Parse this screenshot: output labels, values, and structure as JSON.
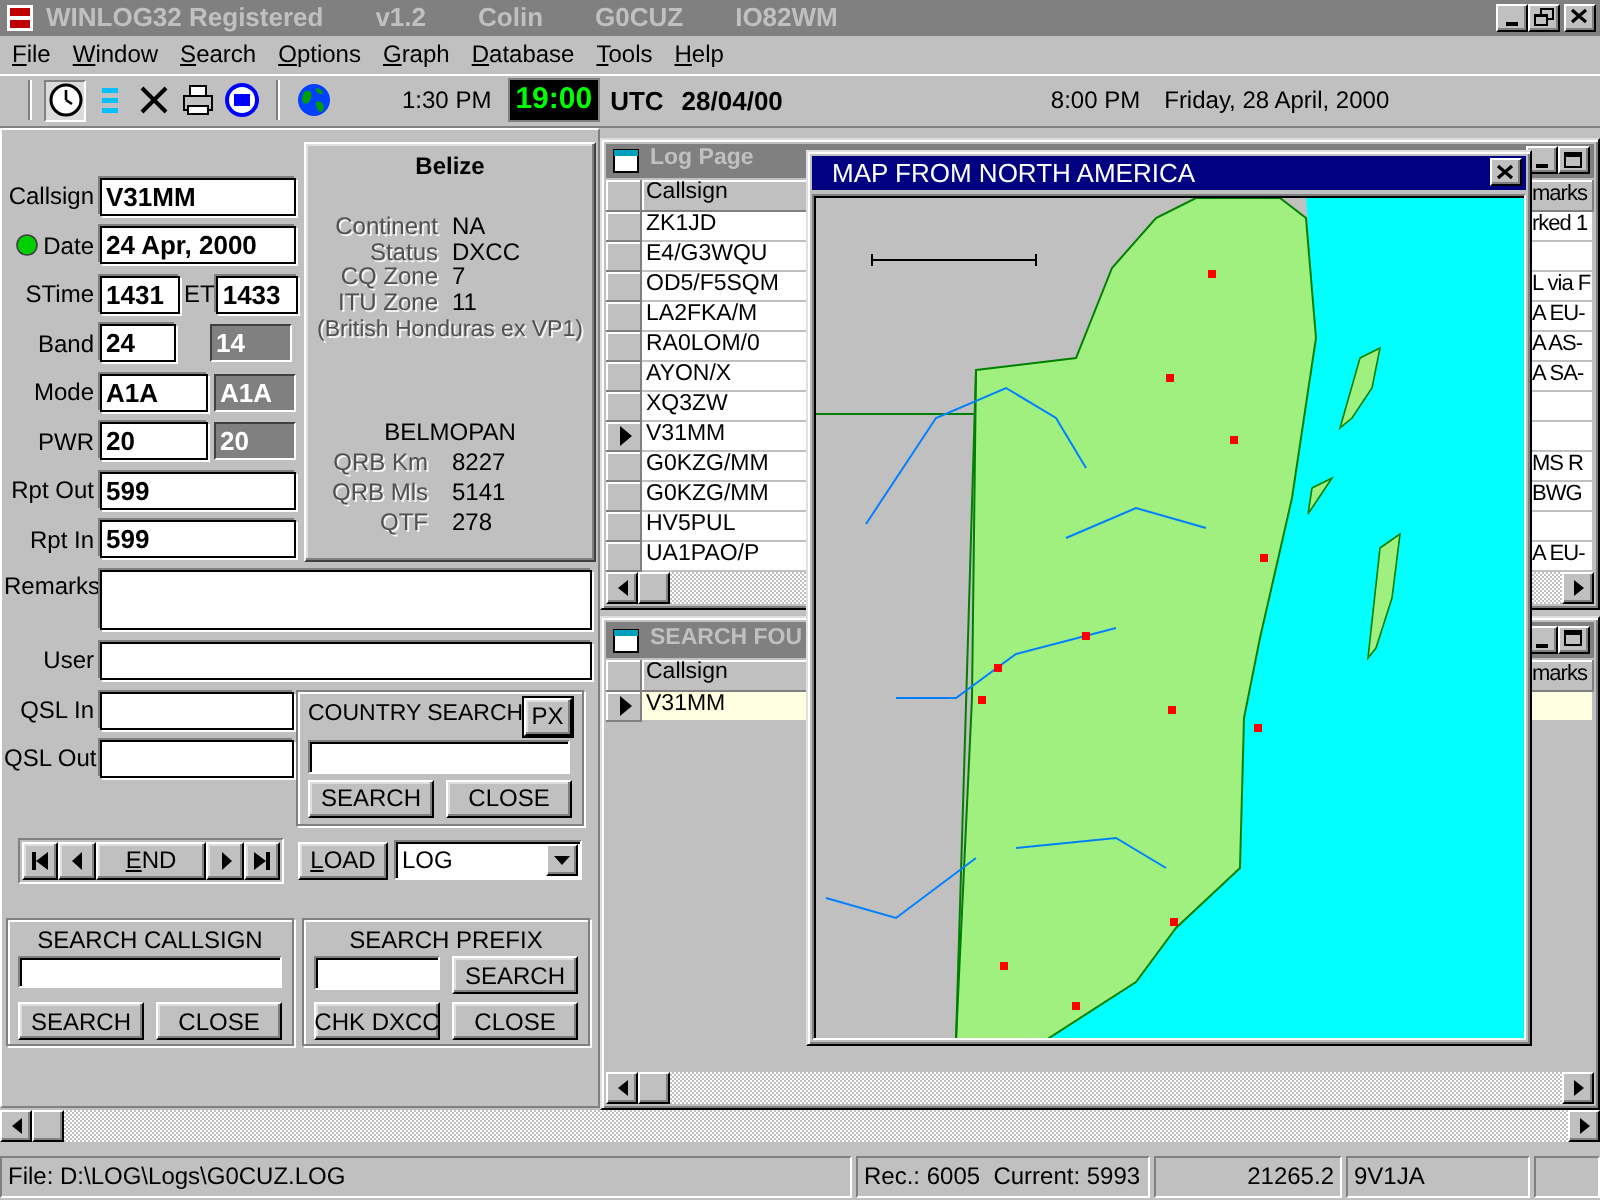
{
  "window": {
    "title_parts": [
      "WINLOG32 Registered",
      "v1.2",
      "Colin",
      "G0CUZ",
      "IO82WM"
    ],
    "active": false
  },
  "menu": [
    {
      "label": "File"
    },
    {
      "label": "Window"
    },
    {
      "label": "Search"
    },
    {
      "label": "Options"
    },
    {
      "label": "Graph"
    },
    {
      "label": "Database"
    },
    {
      "label": "Tools"
    },
    {
      "label": "Help"
    }
  ],
  "toolbar": {
    "tools": [
      {
        "kind": "clock",
        "pressed": true
      },
      {
        "kind": "list",
        "pressed": false
      },
      {
        "kind": "delete",
        "pressed": false
      },
      {
        "kind": "print",
        "pressed": false
      },
      {
        "kind": "dx",
        "pressed": false
      },
      {
        "kind": "globe",
        "pressed": false
      }
    ],
    "local_time": "1:30 PM",
    "utc_time": "19:00",
    "utc_label": "UTC",
    "utc_date": "28/04/00",
    "dx_time": "8:00 PM",
    "dx_date": "Friday, 28 April, 2000"
  },
  "qso": {
    "callsign": {
      "label": "Callsign",
      "value": "V31MM"
    },
    "date": {
      "label": "Date",
      "value": "24 Apr, 2000",
      "lamp_on": true
    },
    "stime": {
      "label": "STime",
      "value": "1431"
    },
    "etime": {
      "label": "ET",
      "value": "1433"
    },
    "band": {
      "label": "Band",
      "value": "24",
      "readout": "14"
    },
    "mode": {
      "label": "Mode",
      "value": "A1A",
      "readout": "A1A"
    },
    "pwr": {
      "label": "PWR",
      "value": "20",
      "readout": "20"
    },
    "rpt_out": {
      "label": "Rpt Out",
      "value": "599"
    },
    "rpt_in": {
      "label": "Rpt In",
      "value": "599"
    },
    "remarks": {
      "label": "Remarks"
    },
    "user": {
      "label": "User"
    },
    "qsl_in": {
      "label": "QSL In"
    },
    "qsl_out": {
      "label": "QSL Out"
    }
  },
  "country_info": {
    "name": "Belize",
    "facts": [
      {
        "label": "Continent",
        "value": "NA"
      },
      {
        "label": "Status",
        "value": "DXCC"
      },
      {
        "label": "CQ Zone",
        "value": "7"
      },
      {
        "label": "ITU Zone",
        "value": "11"
      }
    ],
    "note": "(British Honduras ex VP1)",
    "capital": "BELMOPAN",
    "distances": [
      {
        "label": "QRB Km",
        "value": "8227"
      },
      {
        "label": "QRB Mls",
        "value": "5141"
      },
      {
        "label": "QTF",
        "value": "278"
      }
    ]
  },
  "country_search": {
    "title": "COUNTRY SEARCH",
    "px_button": "PX",
    "buttons": [
      {
        "label": "SEARCH"
      },
      {
        "label": "CLOSE"
      }
    ]
  },
  "navigator": {
    "end_button": {
      "label": "END"
    },
    "load_button": {
      "label": "LOAD"
    },
    "log_select": {
      "value": "LOG"
    }
  },
  "search_callsign": {
    "title": "SEARCH CALLSIGN",
    "buttons": [
      {
        "label": "SEARCH"
      },
      {
        "label": "CLOSE"
      }
    ]
  },
  "search_prefix": {
    "title": "SEARCH PREFIX",
    "buttons": [
      {
        "label": "SEARCH"
      },
      {
        "label": "CHK DXCC"
      },
      {
        "label": "CLOSE"
      }
    ]
  },
  "log_page": {
    "title": "Log Page",
    "columns": [
      "Callsign",
      "marks"
    ],
    "rows": [
      {
        "callsign": "ZK1JD",
        "remarks": "rked 1",
        "selected": false
      },
      {
        "callsign": "E4/G3WQU",
        "selected": false
      },
      {
        "callsign": "OD5/F5SQM",
        "remarks": "L via F",
        "selected": false
      },
      {
        "callsign": "LA2FKA/M",
        "remarks": "A EU-",
        "selected": false
      },
      {
        "callsign": "RA0LOM/0",
        "remarks": "A AS-",
        "selected": false
      },
      {
        "callsign": "AYON/X",
        "remarks": "A SA-",
        "selected": false
      },
      {
        "callsign": "XQ3ZW",
        "selected": false
      },
      {
        "callsign": "V31MM",
        "selected": true
      },
      {
        "callsign": "G0KZG/MM",
        "remarks": "MS R",
        "selected": false
      },
      {
        "callsign": "G0KZG/MM",
        "remarks": "BWG",
        "selected": false
      },
      {
        "callsign": "HV5PUL",
        "selected": false
      },
      {
        "callsign": "UA1PAO/P",
        "remarks": "A EU-",
        "selected": false
      }
    ]
  },
  "search_found": {
    "title": "SEARCH FOU",
    "columns": [
      "Callsign",
      "marks"
    ],
    "rows": [
      {
        "callsign": "V31MM",
        "selected": true,
        "highlighted": true
      }
    ]
  },
  "map_window": {
    "title": "MAP FROM NORTH AMERICA",
    "active": true
  },
  "status_bar": [
    "File: D:\\LOG\\Logs\\G0CUZ.LOG",
    "Rec.: 6005  Current: 5993",
    "21265.2",
    "9V1JA"
  ]
}
